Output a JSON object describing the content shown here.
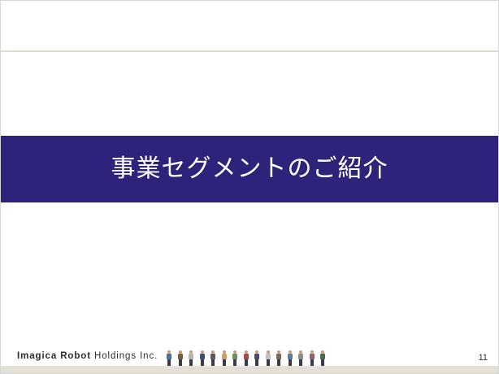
{
  "slide": {
    "title": "事業セグメントのご紹介",
    "page_number": "11"
  },
  "footer": {
    "logo_bold": "Imagica Robot",
    "logo_rest": " Holdings Inc."
  },
  "colors": {
    "title_band": "#2e237a",
    "title_text": "#ffffff"
  },
  "decoration": {
    "people_icon": "row-of-people-illustration",
    "people": [
      {
        "shirt": "#4a6fa5"
      },
      {
        "shirt": "#7a5c3a"
      },
      {
        "shirt": "#b3b3b3"
      },
      {
        "shirt": "#3d4f7a"
      },
      {
        "shirt": "#5a5a5a"
      },
      {
        "shirt": "#d4a05a"
      },
      {
        "shirt": "#6b8e5a"
      },
      {
        "shirt": "#a34a4a"
      },
      {
        "shirt": "#4a4a7a"
      },
      {
        "shirt": "#c0c0c0"
      },
      {
        "shirt": "#7a6a5a"
      },
      {
        "shirt": "#5a7aa5"
      },
      {
        "shirt": "#8a8a8a"
      },
      {
        "shirt": "#9a5a7a"
      },
      {
        "shirt": "#4a6a4a"
      }
    ]
  }
}
